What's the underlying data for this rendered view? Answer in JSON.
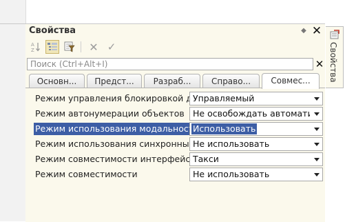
{
  "panel": {
    "title": "Свойства"
  },
  "toolbar": {
    "buttons": [
      "sort-alphabetical-icon",
      "categorized-view-icon",
      "filter-icon",
      "cancel-icon",
      "accept-icon"
    ]
  },
  "search": {
    "placeholder": "Поиск (Ctrl+Alt+I)",
    "value": ""
  },
  "tabs": [
    {
      "label": "Основн...",
      "active": false
    },
    {
      "label": "Предст...",
      "active": false
    },
    {
      "label": "Разраб...",
      "active": false
    },
    {
      "label": "Справо...",
      "active": false
    },
    {
      "label": "Совмес...",
      "active": true
    }
  ],
  "properties": [
    {
      "label": "Режим управления блокировкой данных",
      "value": "Управляемый",
      "selected": false
    },
    {
      "label": "Режим автонумерации объектов",
      "value": "Не освобождать автоматически",
      "selected": false
    },
    {
      "label": "Режим использования модальности",
      "value": "Использовать",
      "selected": true
    },
    {
      "label": "Режим использования синхронных вызовов",
      "value": "Не использовать",
      "selected": false
    },
    {
      "label": "Режим совместимости интерфейса",
      "value": "Такси",
      "selected": false
    },
    {
      "label": "Режим совместимости",
      "value": "Не использовать",
      "selected": false
    }
  ],
  "side_tab": {
    "label": "Свойства"
  },
  "colors": {
    "panel_bg": "#fbf9ec",
    "selection": "#3d5ea5"
  }
}
